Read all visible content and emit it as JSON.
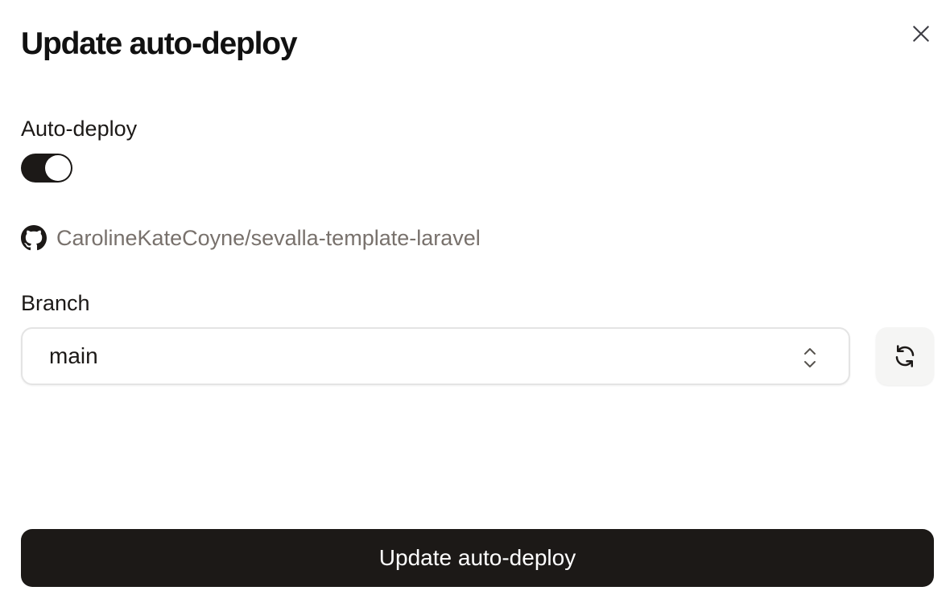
{
  "dialog": {
    "title": "Update auto-deploy"
  },
  "auto_deploy": {
    "label": "Auto-deploy",
    "enabled": true
  },
  "repository": {
    "icon": "github-icon",
    "name": "CarolineKateCoyne/sevalla-template-laravel"
  },
  "branch": {
    "label": "Branch",
    "selected": "main"
  },
  "actions": {
    "submit_label": "Update auto-deploy",
    "close_icon": "close-icon",
    "refresh_icon": "refresh-icon"
  },
  "colors": {
    "primary": "#1c1917",
    "muted_text": "#78716c",
    "border": "#e4e4e4",
    "secondary_bg": "#f5f5f4"
  }
}
